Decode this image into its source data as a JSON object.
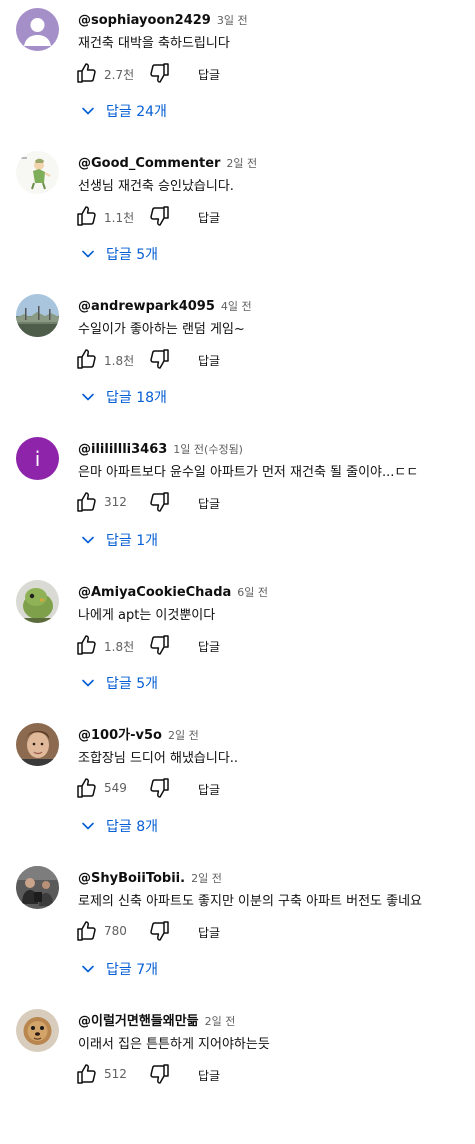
{
  "comments": [
    {
      "author": "@sophiayoon2429",
      "time": "3일 전",
      "text": "재건축 대박을 축하드립니다",
      "likes": "2.7천",
      "reply_label": "답글",
      "replies_label": "답글 24개",
      "avatar": "default-person-avatar"
    },
    {
      "author": "@Good_Commenter",
      "time": "2일 전",
      "text": "선생님 재건축 승인났습니다.",
      "likes": "1.1천",
      "reply_label": "답글",
      "replies_label": "답글 5개",
      "avatar": "cartoon-figure-avatar"
    },
    {
      "author": "@andrewpark4095",
      "time": "4일 전",
      "text": "수일이가 좋아하는 랜덤 게임~",
      "likes": "1.8천",
      "reply_label": "답글",
      "replies_label": "답글 18개",
      "avatar": "landscape-photo-avatar"
    },
    {
      "author": "@ililillli3463",
      "time": "1일 전(수정됨)",
      "text": "은마 아파트보다 윤수일 아파트가 먼저 재건축 될 줄이야...ㄷㄷ",
      "likes": "312",
      "reply_label": "답글",
      "replies_label": "답글 1개",
      "avatar": "letter-i-avatar",
      "avatar_letter": "i"
    },
    {
      "author": "@AmiyaCookieChada",
      "time": "6일 전",
      "text": "나에게 apt는 이것뿐이다",
      "likes": "1.8천",
      "reply_label": "답글",
      "replies_label": "답글 5개",
      "avatar": "bird-photo-avatar"
    },
    {
      "author": "@100가-v5o",
      "time": "2일 전",
      "text": "조합장님 드디어 해냈습니다..",
      "likes": "549",
      "reply_label": "답글",
      "replies_label": "답글 8개",
      "avatar": "person-photo-avatar"
    },
    {
      "author": "@ShyBoiiTobii.",
      "time": "2일 전",
      "text": "로제의 신축 아파트도 좋지만 이분의 구축 아파트 버전도 좋네요",
      "likes": "780",
      "reply_label": "답글",
      "replies_label": "답글 7개",
      "avatar": "people-photo-avatar"
    },
    {
      "author": "@이럴거면핸들왜만듦",
      "time": "2일 전",
      "text": "이래서 집은 튼튼하게 지어야하는듯",
      "likes": "512",
      "reply_label": "답글",
      "avatar": "dog-photo-avatar"
    }
  ],
  "colors": {
    "link": "#065fd4",
    "secondary_text": "#606060",
    "primary_text": "#0f0f0f",
    "letter_avatar_bg": "#8e24aa",
    "default_avatar_bg": "#a58fc9"
  }
}
